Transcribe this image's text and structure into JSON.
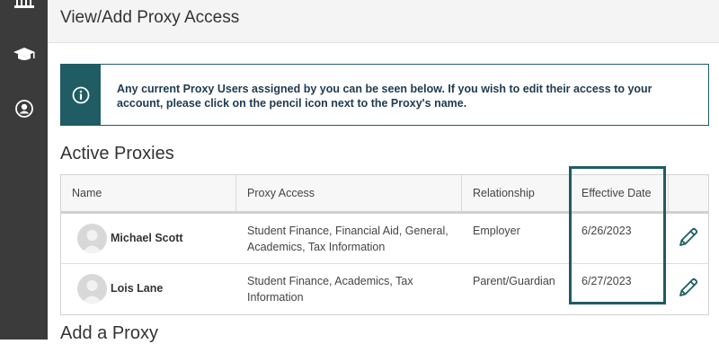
{
  "page": {
    "title": "View/Add Proxy Access"
  },
  "sidebar": {
    "icons": [
      "home-icon",
      "graduation-cap-icon",
      "user-profile-icon"
    ]
  },
  "info_banner": {
    "icon": "info-icon",
    "text": "Any current Proxy Users assigned by you can be seen below. If you wish to edit their access to your account, please click on the pencil icon next to the Proxy's name."
  },
  "active_proxies": {
    "title": "Active Proxies",
    "columns": {
      "name": "Name",
      "access": "Proxy Access",
      "relationship": "Relationship",
      "effective_date": "Effective Date"
    },
    "rows": [
      {
        "name": "Michael Scott",
        "access": "Student Finance, Financial Aid, General, Academics, Tax Information",
        "relationship": "Employer",
        "effective_date": "6/26/2023",
        "edit_icon": "pencil-icon"
      },
      {
        "name": "Lois Lane",
        "access": "Student Finance, Academics, Tax Information",
        "relationship": "Parent/Guardian",
        "effective_date": "6/27/2023",
        "edit_icon": "pencil-icon"
      }
    ]
  },
  "add_proxy": {
    "title": "Add a Proxy"
  },
  "colors": {
    "sidebar": "#3b3b3b",
    "accent": "#1f5c63",
    "banner_text": "#1e3a50"
  }
}
